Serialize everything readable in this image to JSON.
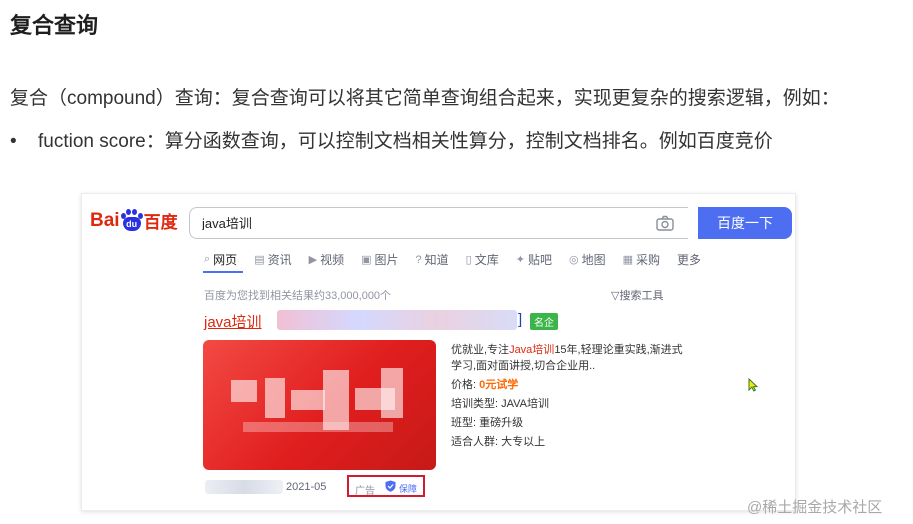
{
  "heading": "复合查询",
  "paragraph": "复合（compound）查询：复合查询可以将其它简单查询组合起来，实现更复杂的搜索逻辑，例如：",
  "bullet": {
    "marker": "•",
    "text": "fuction score：算分函数查询，可以控制文档相关性算分，控制文档排名。例如百度竞价"
  },
  "screenshot": {
    "logo": {
      "left": "Bai",
      "paw": "du",
      "right": "百度"
    },
    "search": {
      "value": "java培训",
      "button": "百度一下"
    },
    "tabs": [
      {
        "icon": "magnifier-icon",
        "label": "网页"
      },
      {
        "icon": "news-icon",
        "label": "资讯"
      },
      {
        "icon": "video-icon",
        "label": "视频"
      },
      {
        "icon": "image-icon",
        "label": "图片"
      },
      {
        "icon": "question-icon",
        "label": "知道"
      },
      {
        "icon": "doc-icon",
        "label": "文库"
      },
      {
        "icon": "tieba-icon",
        "label": "贴吧"
      },
      {
        "icon": "map-icon",
        "label": "地图"
      },
      {
        "icon": "shopping-icon",
        "label": "采购"
      },
      {
        "icon": "",
        "label": "更多"
      }
    ],
    "result_count": "百度为您找到相关结果约33,000,000个",
    "search_tools": "搜索工具",
    "ad": {
      "title": "java培训",
      "title_end": "]",
      "badge": "名企",
      "desc_before": "优就业,专注",
      "desc_highlight": "Java培训",
      "desc_after": "15年,轻理论重实践,渐进式学习,面对面讲授,切合企业用..",
      "fields": [
        {
          "label": "价格:",
          "value": "0元试学",
          "highlight": true
        },
        {
          "label": "培训类型:",
          "value": "JAVA培训"
        },
        {
          "label": "班型:",
          "value": "重磅升级"
        },
        {
          "label": "适合人群:",
          "value": "大专以上"
        }
      ],
      "date": "2021-05",
      "ad_label": "广告",
      "guarantee": "保障"
    }
  },
  "watermark": "@稀土掘金技术社区"
}
